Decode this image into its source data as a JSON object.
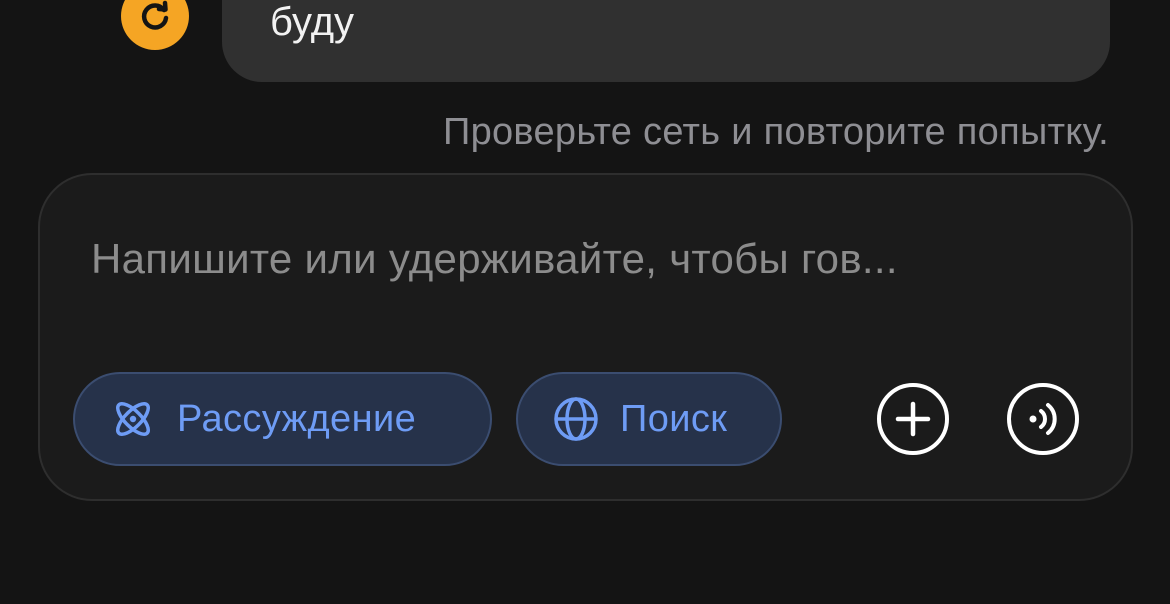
{
  "conversation": {
    "last_user_message": "буду",
    "error_message": "Проверьте сеть и повторите попытку.",
    "retry_icon": "retry-icon"
  },
  "composer": {
    "placeholder": "Напишите или удерживайте, чтобы гов...",
    "chips": {
      "reasoning": {
        "label": "Рассуждение",
        "icon": "atom-icon"
      },
      "search": {
        "label": "Поиск",
        "icon": "globe-icon"
      }
    },
    "add_button_icon": "plus-icon",
    "voice_button_icon": "voice-wave-icon"
  },
  "colors": {
    "background": "#141414",
    "bubble": "#303030",
    "retry_accent": "#f5a524",
    "chip_text": "#6e9cf5",
    "chip_bg": "#26324a"
  }
}
